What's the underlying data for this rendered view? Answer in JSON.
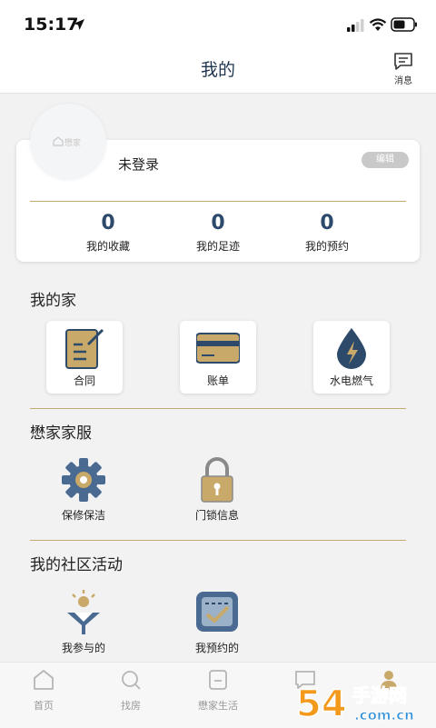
{
  "status_bar": {
    "time": "15:17"
  },
  "header": {
    "title": "我的",
    "message_label": "消息"
  },
  "profile": {
    "avatar_logo_text": "懋家",
    "username": "未登录",
    "edit_label": "编辑",
    "stats": [
      {
        "value": "0",
        "label": "我的收藏"
      },
      {
        "value": "0",
        "label": "我的足迹"
      },
      {
        "value": "0",
        "label": "我的预约"
      }
    ]
  },
  "my_home": {
    "title": "我的家",
    "items": [
      {
        "label": "合同",
        "icon": "contract-icon"
      },
      {
        "label": "账单",
        "icon": "bill-card-icon"
      },
      {
        "label": "水电燃气",
        "icon": "utilities-drop-icon"
      }
    ]
  },
  "services": {
    "title": "懋家家服",
    "items": [
      {
        "label": "保修保洁",
        "icon": "gear-icon"
      },
      {
        "label": "门锁信息",
        "icon": "lock-icon"
      }
    ]
  },
  "community": {
    "title": "我的社区活动",
    "items": [
      {
        "label": "我参与的",
        "icon": "participate-icon"
      },
      {
        "label": "我预约的",
        "icon": "reservation-icon"
      }
    ]
  },
  "tabbar": {
    "items": [
      {
        "label": "首页",
        "icon": "home-icon"
      },
      {
        "label": "找房",
        "icon": "search-icon"
      },
      {
        "label": "懋家生活",
        "icon": "life-icon"
      },
      {
        "label": "",
        "icon": "chat-icon"
      },
      {
        "label": "",
        "icon": "person-icon"
      }
    ]
  },
  "watermark": {
    "text1": "54",
    "text2": "手游网",
    "text3": ".com.cn"
  },
  "colors": {
    "accent": "#2d4a6b",
    "gold": "#c2aa74",
    "gold_fill": "#c9a96a"
  }
}
